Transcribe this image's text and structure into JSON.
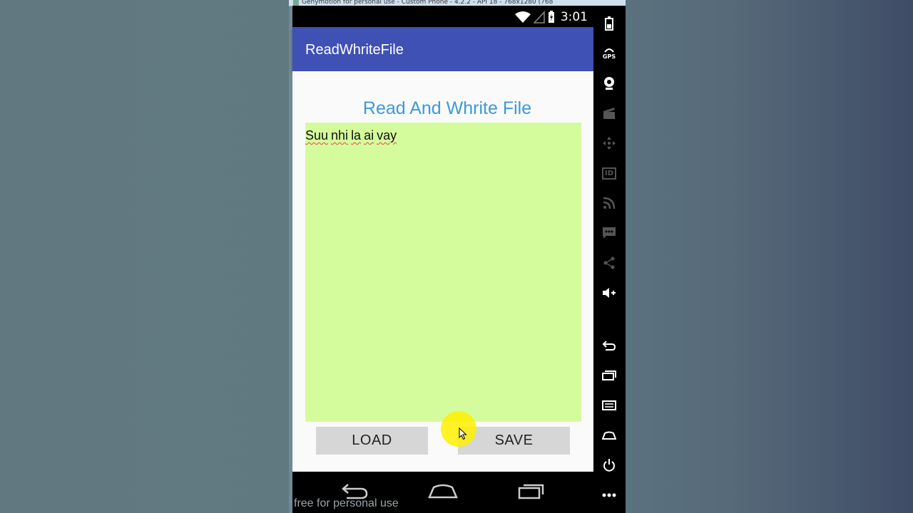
{
  "emulator": {
    "titlebar_text": "Genymotion for personal use - Custom Phone - 4.2.2 - API 18 - 768x1280 (768"
  },
  "status_bar": {
    "time": "3:01"
  },
  "app": {
    "title": "ReadWhriteFile",
    "heading": "Read And Whrite File",
    "editor_words": [
      "Suu",
      "nhi",
      "la",
      "ai",
      "vay"
    ],
    "load_label": "LOAD",
    "save_label": "SAVE"
  },
  "watermark": "free for personal use",
  "sidebar": {
    "gps_label": "GPS",
    "id_label": "ID",
    "icons": [
      "battery-icon",
      "gps-icon",
      "webcam-icon",
      "clapper-icon",
      "dpad-icon",
      "id-icon",
      "rss-icon",
      "sms-icon",
      "share-icon",
      "volume-up-icon",
      "back-icon",
      "recent-apps-icon",
      "menu-icon",
      "home-icon",
      "power-icon",
      "more-icon"
    ]
  },
  "colors": {
    "app_bar": "#3f51b5",
    "heading": "#3a9ad9",
    "editor_bg": "#d5fc9c",
    "button_bg": "#d6d6d6"
  }
}
